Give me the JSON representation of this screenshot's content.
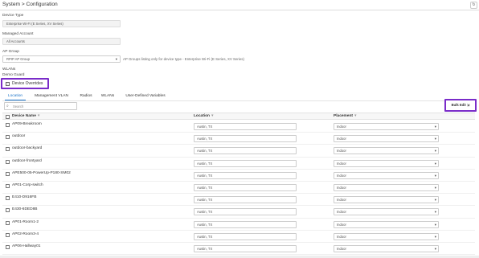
{
  "header": {
    "breadcrumb": "System > Configuration",
    "refresh_icon": "↻"
  },
  "form": {
    "device_type": {
      "label": "Device Type",
      "value": "Enterprise Wi-Fi (E Series, XV Series)"
    },
    "managed_account": {
      "label": "Managed Account",
      "value": "All Accounts"
    },
    "ap_group": {
      "label": "AP Group",
      "value": "RPIP AP Group",
      "hint": "AP Groups listing only for device type - Enterprise Wi-Fi (E Series, XV Series)"
    },
    "wlans": {
      "label": "WLANs",
      "value": "Demo Guard"
    },
    "device_overrides": {
      "label": "Device Overrides",
      "checked_glyph": "−"
    }
  },
  "tabs": [
    "Location",
    "Management VLAN",
    "Radios",
    "WLANs",
    "User-Defined Variables"
  ],
  "search": {
    "placeholder": "Search",
    "icon": "⌕"
  },
  "bulk_edit": {
    "label": "Bulk Edit ⇲"
  },
  "table": {
    "columns": [
      {
        "label": "Device Name",
        "sort": "▾"
      },
      {
        "label": "Location",
        "sort": "▾"
      },
      {
        "label": "Placement",
        "sort": "▾"
      }
    ],
    "rows": [
      {
        "name": "AP09-Breakroom",
        "location": "Austin, TX",
        "placement": "Indoor"
      },
      {
        "name": "outdoor",
        "location": "Austin, TX",
        "placement": "Indoor"
      },
      {
        "name": "outdoor-backyard",
        "location": "Austin, TX",
        "placement": "Indoor"
      },
      {
        "name": "outdoor-frontyard",
        "location": "Austin, TX",
        "placement": "Indoor"
      },
      {
        "name": "APE500-05-PowerUp-P180-SM02",
        "location": "Austin, TX",
        "placement": "Indoor"
      },
      {
        "name": "AP01-Corp-switch",
        "location": "Austin, TX",
        "placement": "Indoor"
      },
      {
        "name": "E410-D916FB",
        "location": "Austin, TX",
        "placement": "Indoor"
      },
      {
        "name": "E430-6DED8B",
        "location": "Austin, TX",
        "placement": "Indoor"
      },
      {
        "name": "AP01-Room1-2",
        "location": "Austin, TX",
        "placement": "Indoor"
      },
      {
        "name": "AP02-Room3-4",
        "location": "Austin, TX",
        "placement": "Indoor"
      },
      {
        "name": "AP06-Hallway01",
        "location": "Austin, TX",
        "placement": "Indoor"
      }
    ]
  },
  "caret": "▾"
}
